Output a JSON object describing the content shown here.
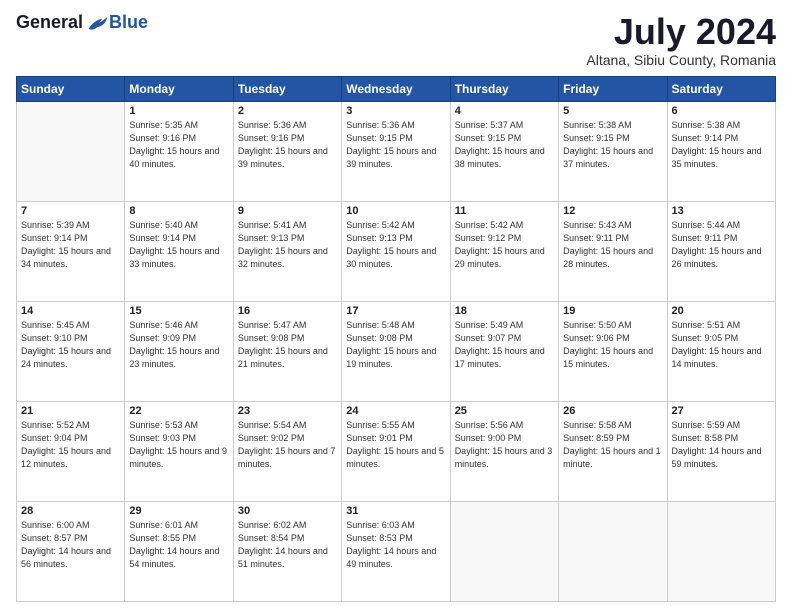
{
  "logo": {
    "general": "General",
    "blue": "Blue"
  },
  "title": "July 2024",
  "location": "Altana, Sibiu County, Romania",
  "days_header": [
    "Sunday",
    "Monday",
    "Tuesday",
    "Wednesday",
    "Thursday",
    "Friday",
    "Saturday"
  ],
  "weeks": [
    [
      {
        "day": "",
        "sunrise": "",
        "sunset": "",
        "daylight": ""
      },
      {
        "day": "1",
        "sunrise": "Sunrise: 5:35 AM",
        "sunset": "Sunset: 9:16 PM",
        "daylight": "Daylight: 15 hours and 40 minutes."
      },
      {
        "day": "2",
        "sunrise": "Sunrise: 5:36 AM",
        "sunset": "Sunset: 9:16 PM",
        "daylight": "Daylight: 15 hours and 39 minutes."
      },
      {
        "day": "3",
        "sunrise": "Sunrise: 5:36 AM",
        "sunset": "Sunset: 9:15 PM",
        "daylight": "Daylight: 15 hours and 39 minutes."
      },
      {
        "day": "4",
        "sunrise": "Sunrise: 5:37 AM",
        "sunset": "Sunset: 9:15 PM",
        "daylight": "Daylight: 15 hours and 38 minutes."
      },
      {
        "day": "5",
        "sunrise": "Sunrise: 5:38 AM",
        "sunset": "Sunset: 9:15 PM",
        "daylight": "Daylight: 15 hours and 37 minutes."
      },
      {
        "day": "6",
        "sunrise": "Sunrise: 5:38 AM",
        "sunset": "Sunset: 9:14 PM",
        "daylight": "Daylight: 15 hours and 35 minutes."
      }
    ],
    [
      {
        "day": "7",
        "sunrise": "Sunrise: 5:39 AM",
        "sunset": "Sunset: 9:14 PM",
        "daylight": "Daylight: 15 hours and 34 minutes."
      },
      {
        "day": "8",
        "sunrise": "Sunrise: 5:40 AM",
        "sunset": "Sunset: 9:14 PM",
        "daylight": "Daylight: 15 hours and 33 minutes."
      },
      {
        "day": "9",
        "sunrise": "Sunrise: 5:41 AM",
        "sunset": "Sunset: 9:13 PM",
        "daylight": "Daylight: 15 hours and 32 minutes."
      },
      {
        "day": "10",
        "sunrise": "Sunrise: 5:42 AM",
        "sunset": "Sunset: 9:13 PM",
        "daylight": "Daylight: 15 hours and 30 minutes."
      },
      {
        "day": "11",
        "sunrise": "Sunrise: 5:42 AM",
        "sunset": "Sunset: 9:12 PM",
        "daylight": "Daylight: 15 hours and 29 minutes."
      },
      {
        "day": "12",
        "sunrise": "Sunrise: 5:43 AM",
        "sunset": "Sunset: 9:11 PM",
        "daylight": "Daylight: 15 hours and 28 minutes."
      },
      {
        "day": "13",
        "sunrise": "Sunrise: 5:44 AM",
        "sunset": "Sunset: 9:11 PM",
        "daylight": "Daylight: 15 hours and 26 minutes."
      }
    ],
    [
      {
        "day": "14",
        "sunrise": "Sunrise: 5:45 AM",
        "sunset": "Sunset: 9:10 PM",
        "daylight": "Daylight: 15 hours and 24 minutes."
      },
      {
        "day": "15",
        "sunrise": "Sunrise: 5:46 AM",
        "sunset": "Sunset: 9:09 PM",
        "daylight": "Daylight: 15 hours and 23 minutes."
      },
      {
        "day": "16",
        "sunrise": "Sunrise: 5:47 AM",
        "sunset": "Sunset: 9:08 PM",
        "daylight": "Daylight: 15 hours and 21 minutes."
      },
      {
        "day": "17",
        "sunrise": "Sunrise: 5:48 AM",
        "sunset": "Sunset: 9:08 PM",
        "daylight": "Daylight: 15 hours and 19 minutes."
      },
      {
        "day": "18",
        "sunrise": "Sunrise: 5:49 AM",
        "sunset": "Sunset: 9:07 PM",
        "daylight": "Daylight: 15 hours and 17 minutes."
      },
      {
        "day": "19",
        "sunrise": "Sunrise: 5:50 AM",
        "sunset": "Sunset: 9:06 PM",
        "daylight": "Daylight: 15 hours and 15 minutes."
      },
      {
        "day": "20",
        "sunrise": "Sunrise: 5:51 AM",
        "sunset": "Sunset: 9:05 PM",
        "daylight": "Daylight: 15 hours and 14 minutes."
      }
    ],
    [
      {
        "day": "21",
        "sunrise": "Sunrise: 5:52 AM",
        "sunset": "Sunset: 9:04 PM",
        "daylight": "Daylight: 15 hours and 12 minutes."
      },
      {
        "day": "22",
        "sunrise": "Sunrise: 5:53 AM",
        "sunset": "Sunset: 9:03 PM",
        "daylight": "Daylight: 15 hours and 9 minutes."
      },
      {
        "day": "23",
        "sunrise": "Sunrise: 5:54 AM",
        "sunset": "Sunset: 9:02 PM",
        "daylight": "Daylight: 15 hours and 7 minutes."
      },
      {
        "day": "24",
        "sunrise": "Sunrise: 5:55 AM",
        "sunset": "Sunset: 9:01 PM",
        "daylight": "Daylight: 15 hours and 5 minutes."
      },
      {
        "day": "25",
        "sunrise": "Sunrise: 5:56 AM",
        "sunset": "Sunset: 9:00 PM",
        "daylight": "Daylight: 15 hours and 3 minutes."
      },
      {
        "day": "26",
        "sunrise": "Sunrise: 5:58 AM",
        "sunset": "Sunset: 8:59 PM",
        "daylight": "Daylight: 15 hours and 1 minute."
      },
      {
        "day": "27",
        "sunrise": "Sunrise: 5:59 AM",
        "sunset": "Sunset: 8:58 PM",
        "daylight": "Daylight: 14 hours and 59 minutes."
      }
    ],
    [
      {
        "day": "28",
        "sunrise": "Sunrise: 6:00 AM",
        "sunset": "Sunset: 8:57 PM",
        "daylight": "Daylight: 14 hours and 56 minutes."
      },
      {
        "day": "29",
        "sunrise": "Sunrise: 6:01 AM",
        "sunset": "Sunset: 8:55 PM",
        "daylight": "Daylight: 14 hours and 54 minutes."
      },
      {
        "day": "30",
        "sunrise": "Sunrise: 6:02 AM",
        "sunset": "Sunset: 8:54 PM",
        "daylight": "Daylight: 14 hours and 51 minutes."
      },
      {
        "day": "31",
        "sunrise": "Sunrise: 6:03 AM",
        "sunset": "Sunset: 8:53 PM",
        "daylight": "Daylight: 14 hours and 49 minutes."
      },
      {
        "day": "",
        "sunrise": "",
        "sunset": "",
        "daylight": ""
      },
      {
        "day": "",
        "sunrise": "",
        "sunset": "",
        "daylight": ""
      },
      {
        "day": "",
        "sunrise": "",
        "sunset": "",
        "daylight": ""
      }
    ]
  ]
}
